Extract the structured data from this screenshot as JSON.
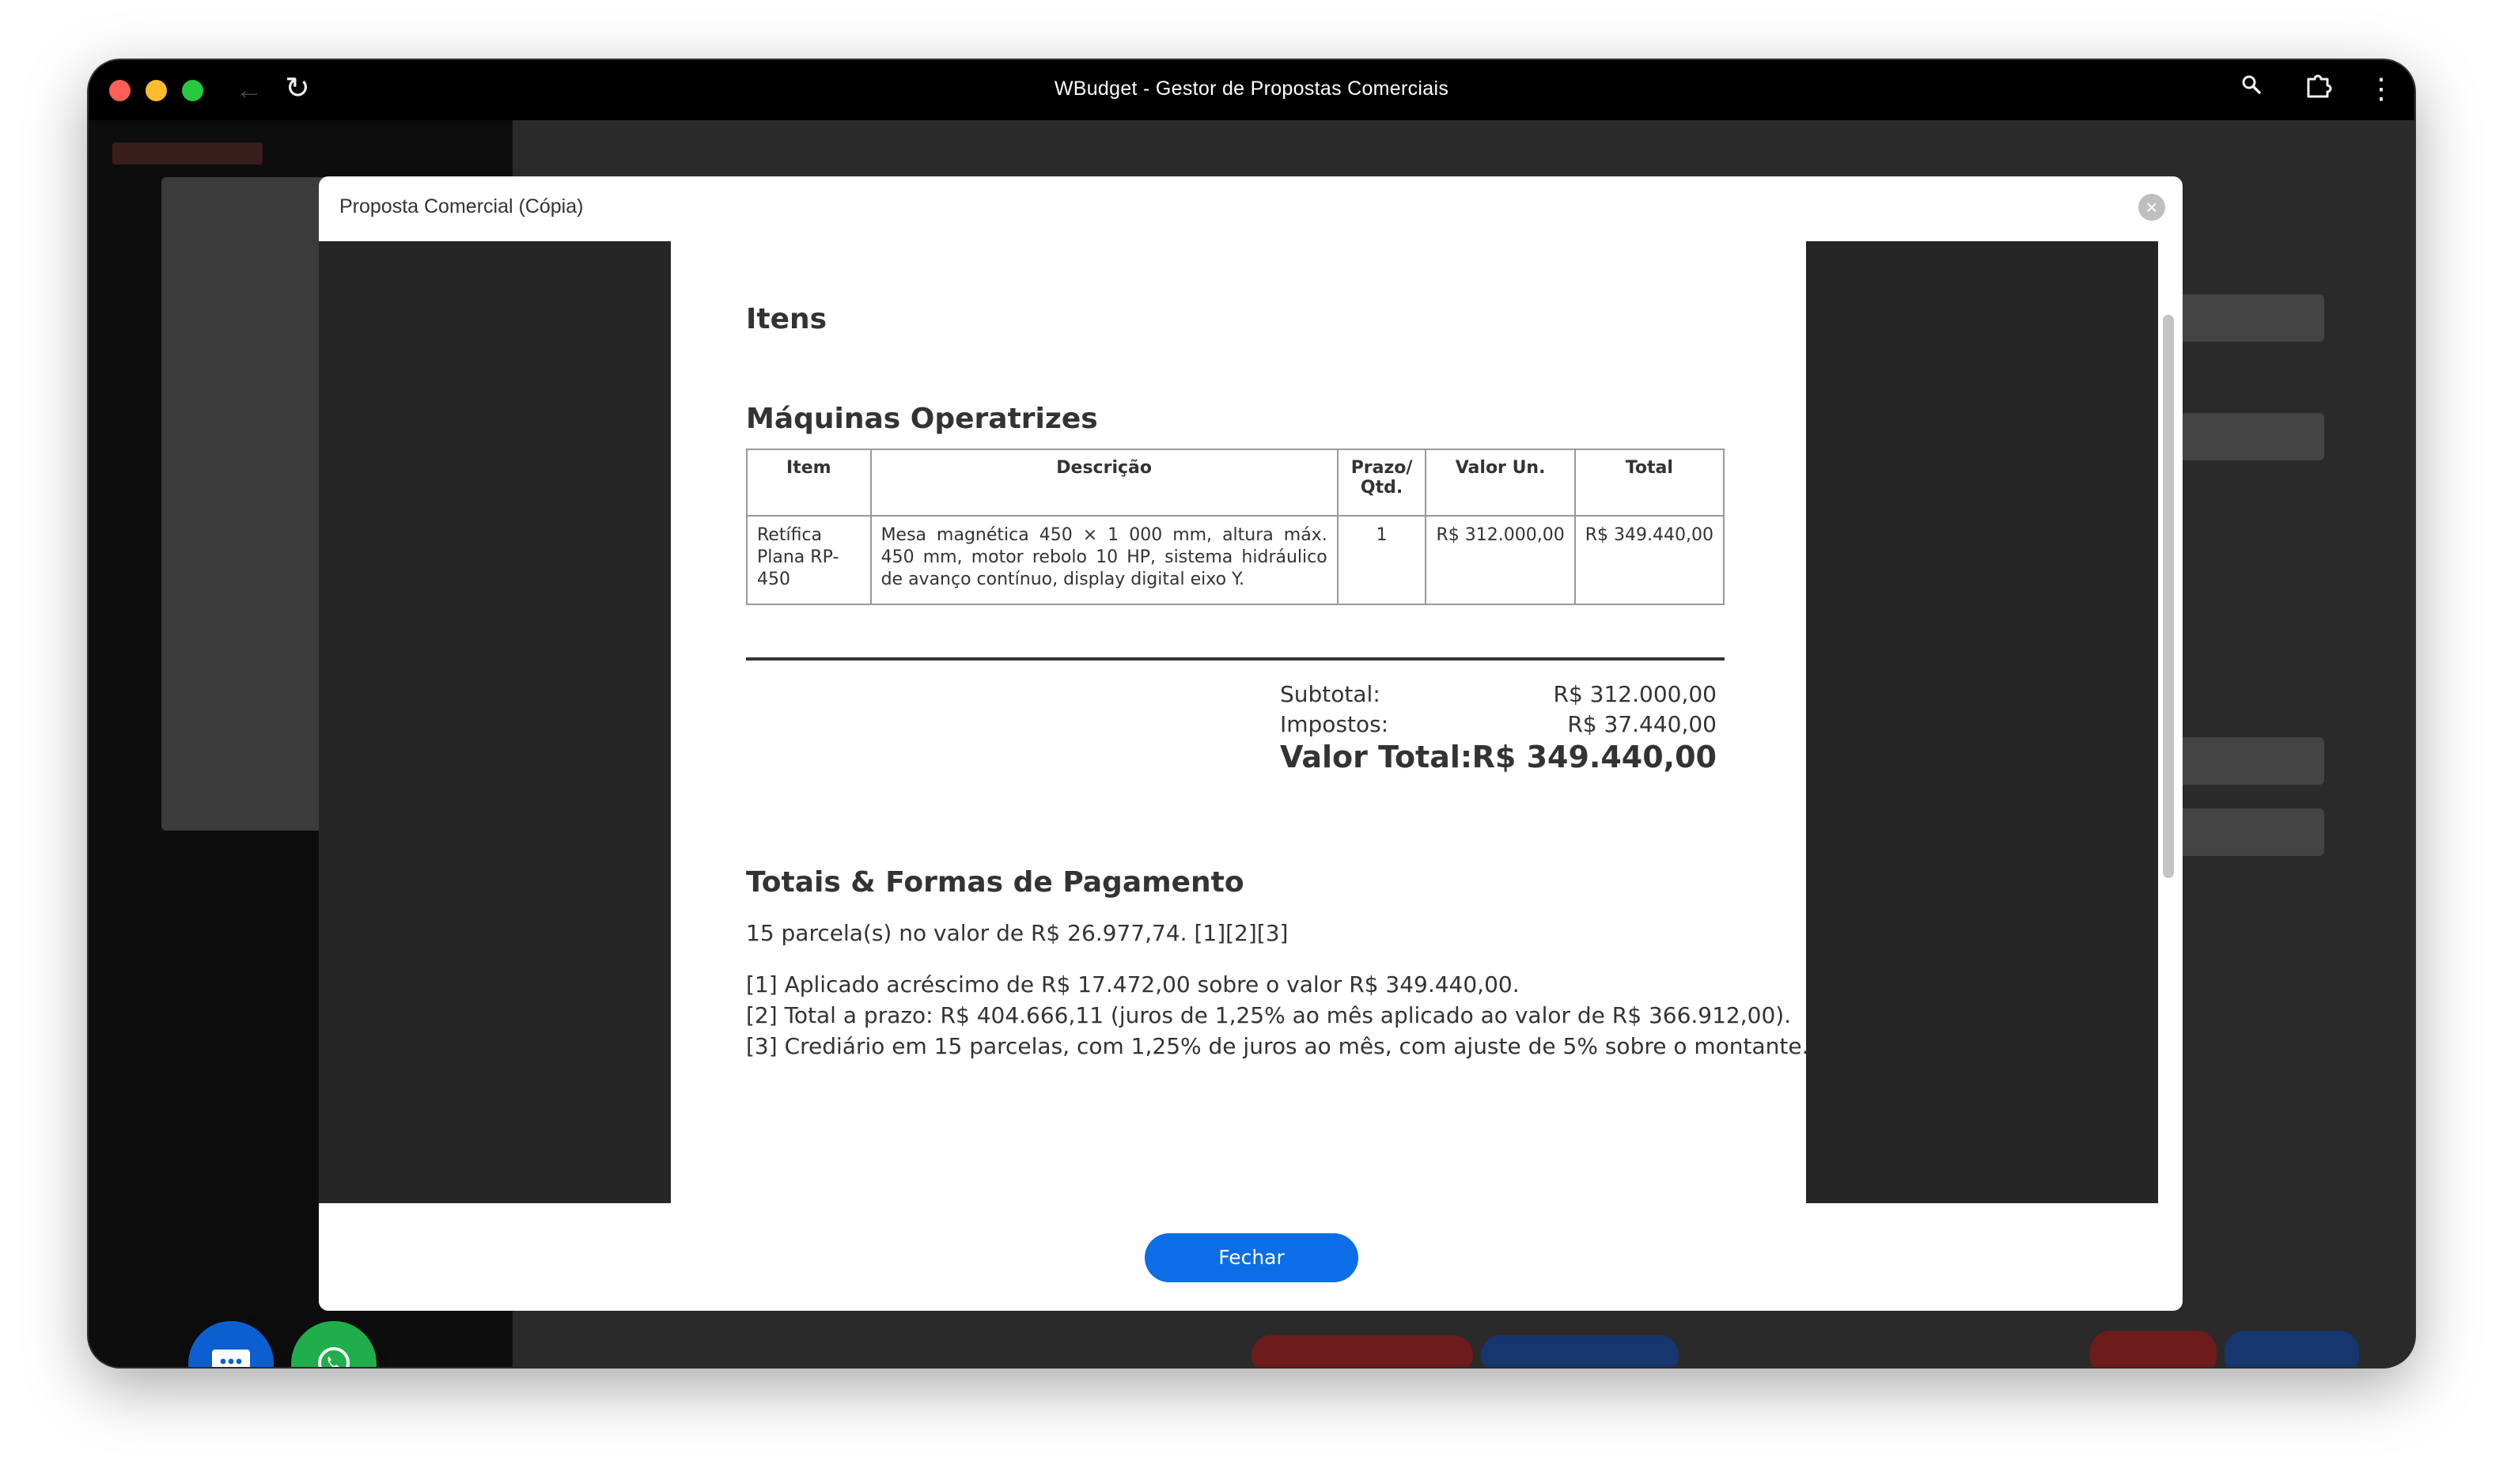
{
  "window": {
    "title": "WBudget - Gestor de Propostas Comerciais"
  },
  "icons": {
    "back": "arrow-left-icon",
    "reload": "reload-icon",
    "zoom": "zoom-icon",
    "extensions": "puzzle-icon",
    "menu": "kebab-menu-icon",
    "close": "close-circle-icon",
    "chat": "chat-bubble-icon",
    "whatsapp": "whatsapp-icon"
  },
  "colors": {
    "primary_button": "#0b6ee6",
    "chat_fab": "#0b5fd0",
    "whatsapp_fab": "#1fae4b"
  },
  "modal": {
    "title": "Proposta Comercial (Cópia)",
    "close_button_label": "Fechar"
  },
  "document": {
    "heading_itens": "Itens",
    "section_title": "Máquinas Operatrizes",
    "table": {
      "headers": {
        "item": "Item",
        "description": "Descrição",
        "prazo_qtd": "Prazo/ Qtd.",
        "unit_value": "Valor Un.",
        "total": "Total"
      },
      "rows": [
        {
          "item": "Retífica Plana RP-450",
          "description": "Mesa magnética 450 × 1 000 mm, altura máx. 450 mm, motor rebolo 10 HP, sistema hidráulico de avanço contínuo, display digital eixo Y.",
          "qty": "1",
          "unit_value": "R$ 312.000,00",
          "total": "R$ 349.440,00"
        }
      ]
    },
    "totals": {
      "subtotal_label": "Subtotal:",
      "subtotal_value": "R$ 312.000,00",
      "taxes_label": "Impostos:",
      "taxes_value": "R$ 37.440,00",
      "total_label": "Valor Total:",
      "total_value": "R$ 349.440,00"
    },
    "payment": {
      "heading": "Totais & Formas de Pagamento",
      "installments": "15 parcela(s) no valor de R$ 26.977,74. [1][2][3]",
      "notes": [
        "[1] Aplicado acréscimo de R$ 17.472,00 sobre o valor R$ 349.440,00.",
        "[2] Total a prazo: R$ 404.666,11 (juros de 1,25% ao mês aplicado ao valor de R$ 366.912,00).",
        "[3] Crediário em 15 parcelas, com 1,25% de juros ao mês, com ajuste de 5% sobre o montante."
      ]
    }
  }
}
